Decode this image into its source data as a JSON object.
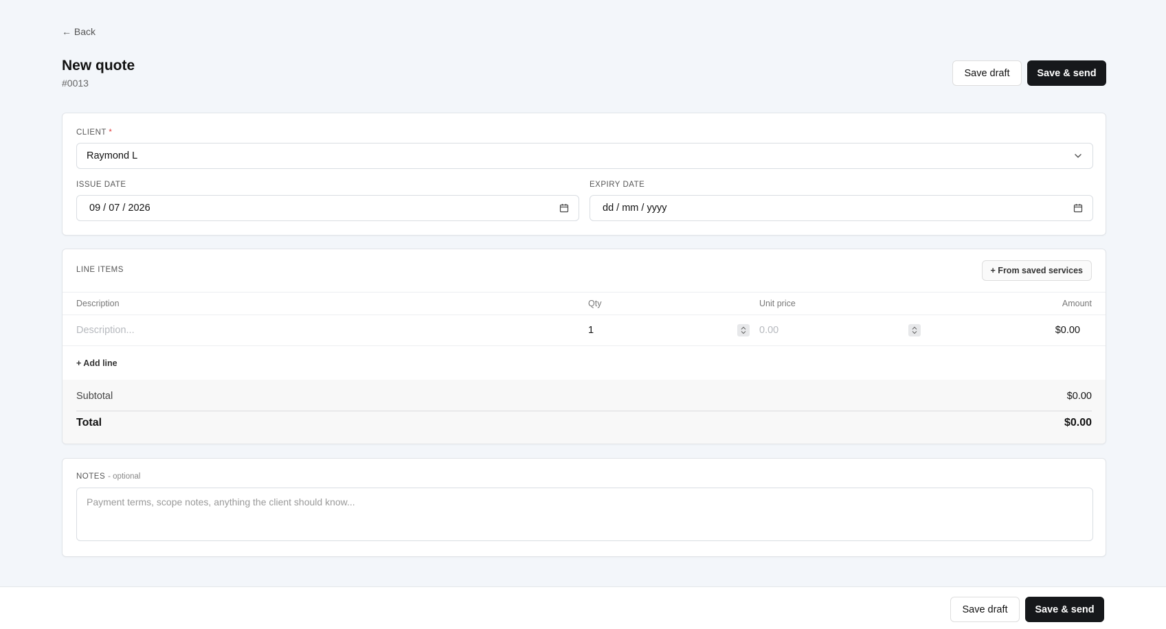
{
  "nav": {
    "back_label": "← Back"
  },
  "header": {
    "title": "New quote",
    "quote_number": "#0013"
  },
  "actions": {
    "save_draft_label": "Save draft",
    "save_send_label": "Save & send"
  },
  "client": {
    "label": "CLIENT",
    "required_mark": "*",
    "value": "Raymond L",
    "issue_date_label": "ISSUE DATE",
    "issue_date_value": "09 / 07 / 2026",
    "expiry_date_label": "EXPIRY DATE",
    "expiry_date_value": "dd / mm / yyyy"
  },
  "line_items": {
    "section_label": "LINE ITEMS",
    "from_saved_label": "+ From saved services",
    "columns": {
      "description": "Description",
      "qty": "Qty",
      "unit_price": "Unit price",
      "amount": "Amount"
    },
    "rows": [
      {
        "description_placeholder": "Description...",
        "qty": "1",
        "unit_price_placeholder": "0.00",
        "amount": "$0.00"
      }
    ],
    "add_line_label": "+ Add line",
    "subtotal_label": "Subtotal",
    "subtotal_value": "$0.00",
    "total_label": "Total",
    "total_value": "$0.00"
  },
  "notes": {
    "label": "NOTES",
    "optional_hint": "- optional",
    "placeholder": "Payment terms, scope notes, anything the client should know..."
  },
  "colors": {
    "primary_button": "#16181b",
    "background": "#f3f6fa",
    "required": "#e03c3c"
  }
}
